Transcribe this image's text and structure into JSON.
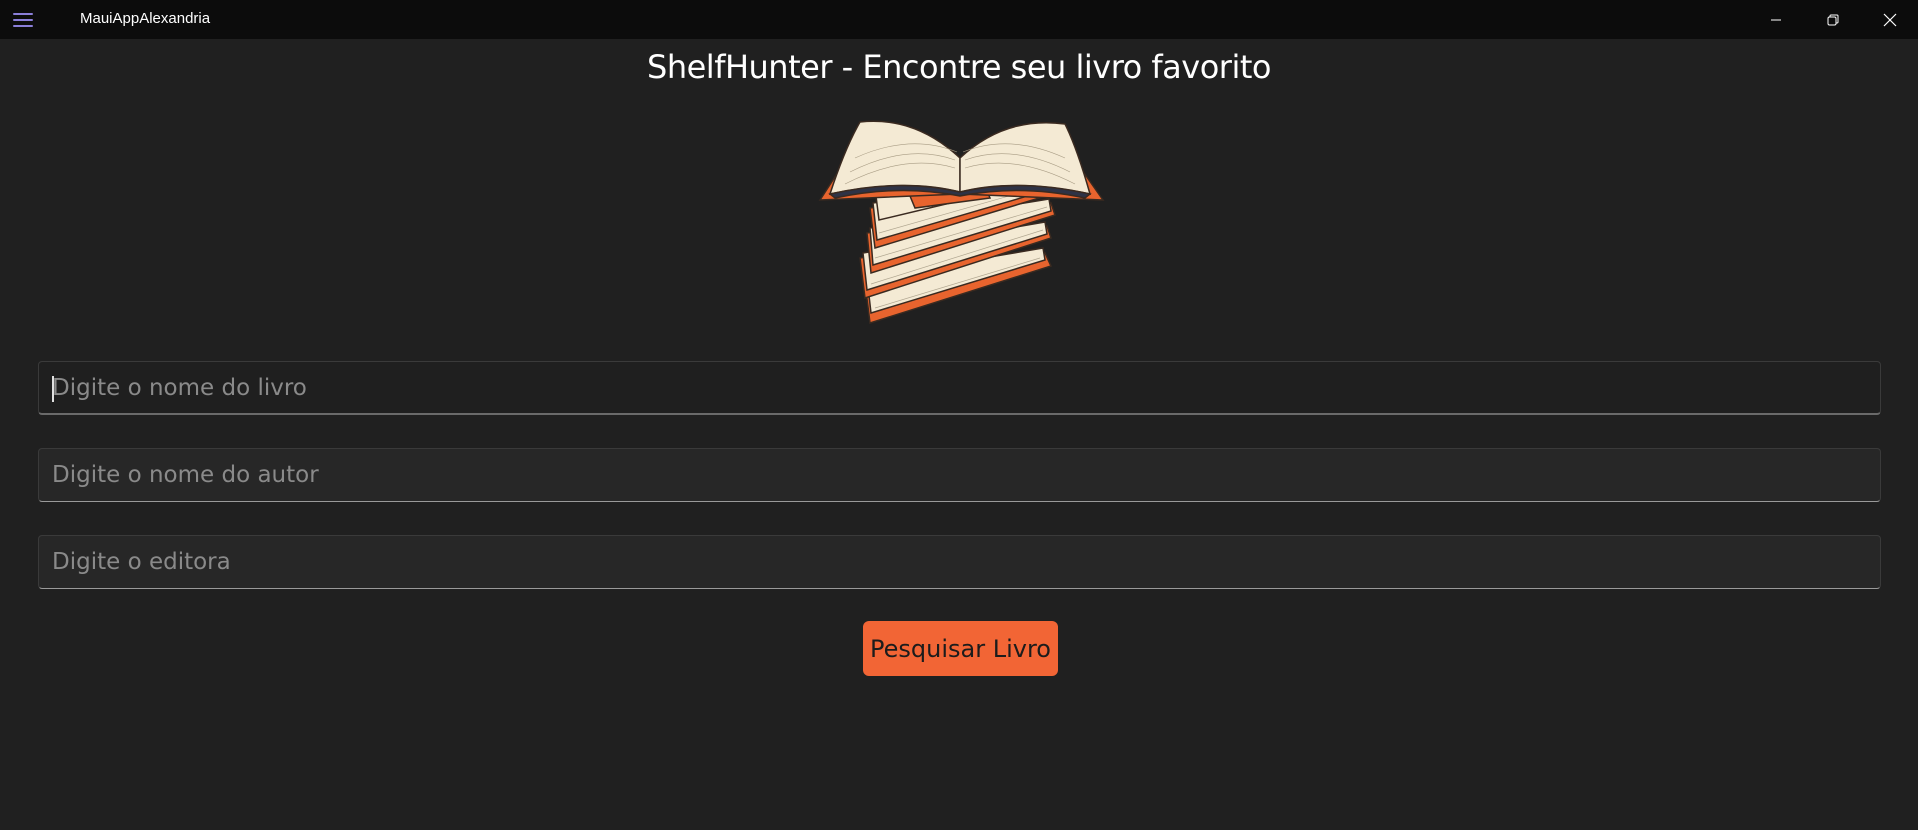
{
  "window": {
    "app_title": "MauiAppAlexandria",
    "accent_color": "#8b7fd9"
  },
  "main": {
    "title": "ShelfHunter - Encontre seu livro favorito",
    "fields": [
      {
        "placeholder": "Digite o nome do livro",
        "value": "",
        "focused": true
      },
      {
        "placeholder": "Digite o nome do autor",
        "value": ""
      },
      {
        "placeholder": "Digite o editora",
        "value": ""
      }
    ],
    "search_button_label": "Pesquisar Livro",
    "button_color": "#f26535"
  }
}
